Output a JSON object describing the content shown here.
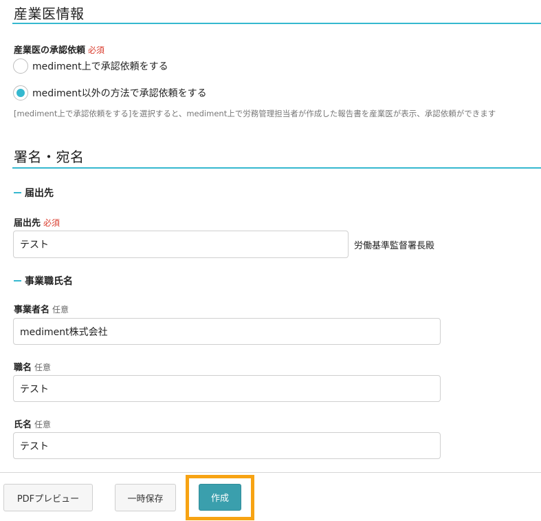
{
  "sections": {
    "occupational_physician": {
      "title": "産業医情報",
      "approval_label": "産業医の承認依頼",
      "approval_badge": "必須",
      "radio_options": [
        {
          "label": "mediment上で承認依頼をする",
          "checked": false
        },
        {
          "label": "mediment以外の方法で承認依頼をする",
          "checked": true
        }
      ],
      "help_text": "[mediment上で承認依頼をする]を選択すると、mediment上で労務管理担当者が作成した報告書を産業医が表示、承認依頼ができます"
    },
    "signature": {
      "title": "署名・宛名",
      "destination_heading": "届出先",
      "destination_label": "届出先",
      "destination_badge": "必須",
      "destination_value": "テスト",
      "destination_suffix": "労働基準監督署長殿",
      "employer_heading": "事業職氏名",
      "company_label": "事業者名",
      "company_badge": "任意",
      "company_value": "mediment株式会社",
      "position_label": "職名",
      "position_badge": "任意",
      "position_value": "テスト",
      "name_label": "氏名",
      "name_badge": "任意",
      "name_value": "テスト"
    }
  },
  "footer": {
    "pdf_preview_label": "PDFプレビュー",
    "save_draft_label": "一時保存",
    "create_label": "作成"
  },
  "colors": {
    "accent": "#35b8cf",
    "required": "#d93a2b",
    "primary_button": "#3a9fad",
    "highlight": "#f7a313"
  }
}
